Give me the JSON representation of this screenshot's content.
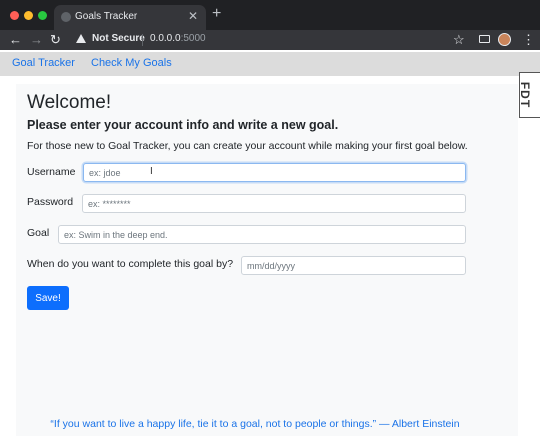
{
  "browser": {
    "tab_title": "Goals Tracker",
    "tab_close": "✕",
    "new_tab": "+",
    "security_label": "Not Secure",
    "url_host": "0.0.0.0",
    "url_port": ":5000",
    "icons": {
      "back": "←",
      "forward": "→",
      "reload": "↻",
      "bookmark": "☆",
      "menu": "⋮"
    }
  },
  "app_nav": {
    "home": "Goal Tracker",
    "check_goals": "Check My Goals"
  },
  "badge": "FDT",
  "form": {
    "welcome": "Welcome!",
    "subheading": "Please enter your account info and write a new goal.",
    "intro": "For those new to Goal Tracker, you can create your account while making your first goal below.",
    "username_label": "Username",
    "username_placeholder": "ex: jdoe",
    "password_label": "Password",
    "password_placeholder": "ex: ********",
    "goal_label": "Goal",
    "goal_placeholder": "ex: Swim in the deep end.",
    "date_label": "When do you want to complete this goal by?",
    "date_placeholder": "mm/dd/yyyy",
    "save_label": "Save!"
  },
  "quote": "“If you want to live a happy life, tie it to a goal, not to people or things.” — Albert Einstein",
  "colors": {
    "link": "#1a73e8",
    "primary_button": "#0d6efd",
    "nav_background": "#dcdcdc",
    "card_background": "#f8f9fa"
  }
}
